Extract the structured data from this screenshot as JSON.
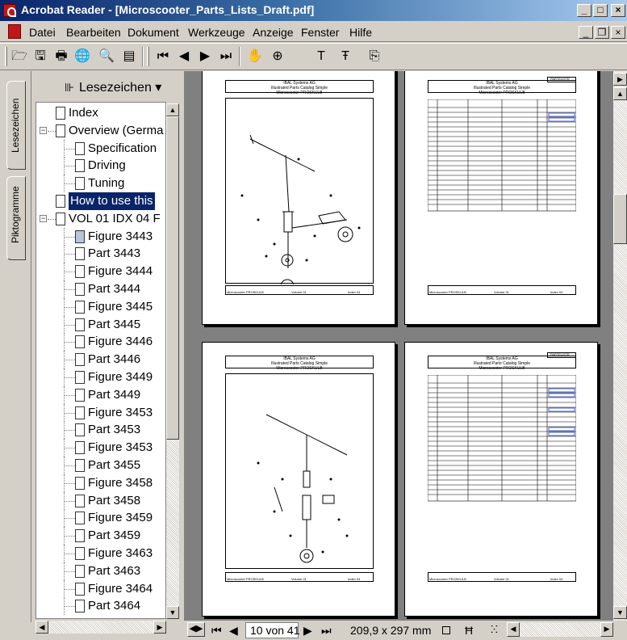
{
  "window": {
    "title": "Acrobat Reader - [Microscooter_Parts_Lists_Draft.pdf]",
    "controls": {
      "minimize": "_",
      "maximize": "□",
      "close": "×"
    }
  },
  "menu": [
    {
      "label": "Datei"
    },
    {
      "label": "Bearbeiten"
    },
    {
      "label": "Dokument"
    },
    {
      "label": "Werkzeuge"
    },
    {
      "label": "Anzeige"
    },
    {
      "label": "Fenster"
    },
    {
      "label": "Hilfe"
    }
  ],
  "doc_controls": {
    "minimize": "_",
    "restore": "❐",
    "close": "×"
  },
  "toolbar": {
    "open": "🗁",
    "save": "🖫",
    "print": "🖶",
    "email": "🌐",
    "search": "🔍",
    "panel": "▤",
    "first": "⏮",
    "prev": "◀",
    "next": "▶",
    "last": "⏭",
    "hand": "✋",
    "zoom": "⊕",
    "text_select": "T",
    "table_select": "Ŧ",
    "snapshot": "⎘"
  },
  "side_tabs": {
    "bookmarks": "Lesezeichen",
    "thumbnails": "Piktogramme"
  },
  "bookmarks": {
    "header": "Lesezeichen ▾",
    "items": [
      {
        "label": "Index",
        "level": 0
      },
      {
        "label": "Overview (Germa",
        "level": 0,
        "expander": "⊟"
      },
      {
        "label": "Specification",
        "level": 1
      },
      {
        "label": "Driving",
        "level": 1
      },
      {
        "label": "Tuning",
        "level": 1
      },
      {
        "label": "How to use this",
        "level": 0,
        "selected": true
      },
      {
        "label": "VOL 01 IDX 04 F",
        "level": 0,
        "expander": "⊟"
      },
      {
        "label": "Figure 3443",
        "level": 1,
        "grey": true
      },
      {
        "label": "Part 3443",
        "level": 1
      },
      {
        "label": "Figure 3444",
        "level": 1
      },
      {
        "label": "Part 3444",
        "level": 1
      },
      {
        "label": "Figure 3445",
        "level": 1
      },
      {
        "label": "Part 3445",
        "level": 1
      },
      {
        "label": "Figure 3446",
        "level": 1
      },
      {
        "label": "Part 3446",
        "level": 1
      },
      {
        "label": "Figure 3449",
        "level": 1
      },
      {
        "label": "Part 3449",
        "level": 1
      },
      {
        "label": "Figure 3453",
        "level": 1
      },
      {
        "label": "Part 3453",
        "level": 1
      },
      {
        "label": "Figure 3453",
        "level": 1
      },
      {
        "label": "Part 3455",
        "level": 1
      },
      {
        "label": "Figure 3458",
        "level": 1
      },
      {
        "label": "Part 3458",
        "level": 1
      },
      {
        "label": "Figure 3459",
        "level": 1
      },
      {
        "label": "Part 3459",
        "level": 1
      },
      {
        "label": "Figure 3463",
        "level": 1
      },
      {
        "label": "Part 3463",
        "level": 1
      },
      {
        "label": "Figure 3464",
        "level": 1
      },
      {
        "label": "Part 3464",
        "level": 1
      }
    ]
  },
  "pages": {
    "header_line1": "IBAL Systems AG",
    "header_line2": "Illustrated Parts Catalog Simple",
    "header_line3": "Microscooter PROSKULB",
    "parts_tag": "PARTELISTE",
    "footer_left": "Microscooter PROSKULB",
    "footer_mid": "Volume 01",
    "footer_right": "Index 04"
  },
  "status": {
    "page_field": "10 von 41",
    "page_size": "209,9 x 297 mm",
    "first": "⏮",
    "prev": "◀",
    "next": "▶",
    "last": "⏭"
  }
}
